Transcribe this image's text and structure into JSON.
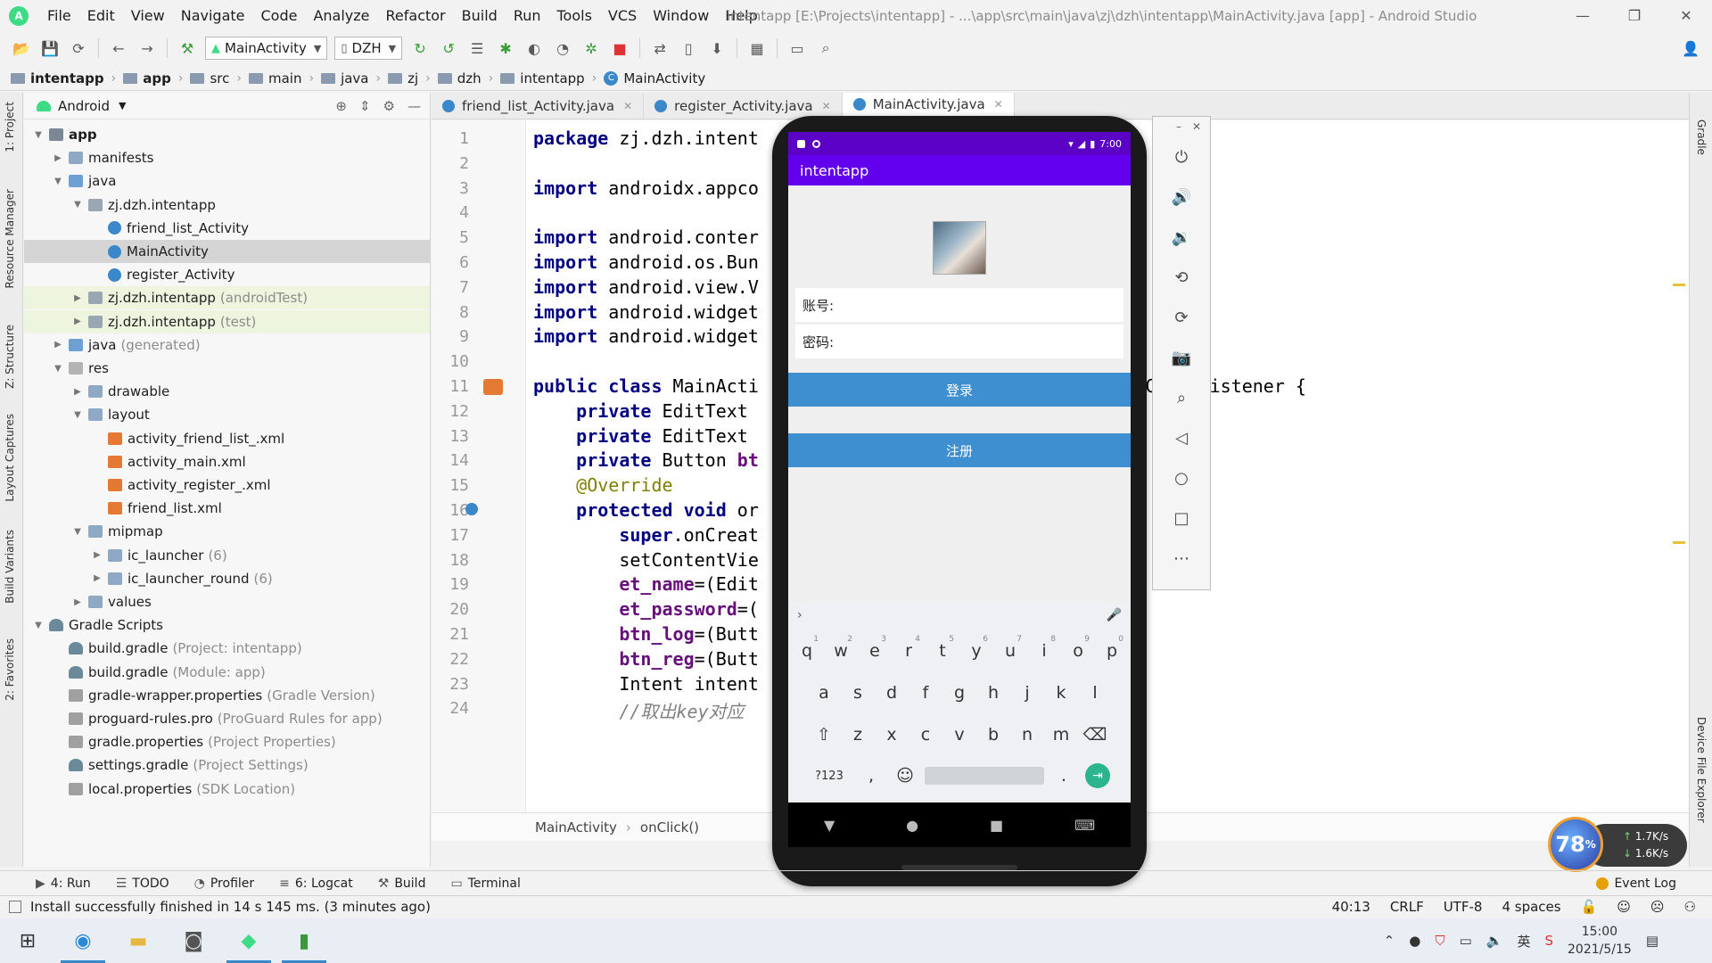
{
  "window": {
    "title": "intentapp [E:\\Projects\\intentapp] - ...\\app\\src\\main\\java\\zj\\dzh\\intentapp\\MainActivity.java [app] - Android Studio",
    "minimize": "—",
    "restore": "❐",
    "close": "✕"
  },
  "menu": [
    "File",
    "Edit",
    "View",
    "Navigate",
    "Code",
    "Analyze",
    "Refactor",
    "Build",
    "Run",
    "Tools",
    "VCS",
    "Window",
    "Help"
  ],
  "toolbar": {
    "run_config": "MainActivity",
    "device": "DZH"
  },
  "breadcrumb": [
    "intentapp",
    "app",
    "src",
    "main",
    "java",
    "zj",
    "dzh",
    "intentapp",
    "MainActivity"
  ],
  "left_strip": [
    "1: Project",
    "Resource Manager",
    "Z: Structure",
    "Layout Captures",
    "Build Variants",
    "2: Favorites"
  ],
  "right_strip": [
    "Gradle",
    "Device File Explorer"
  ],
  "project_panel": {
    "view_mode": "Android",
    "tree": [
      {
        "label": "app",
        "hint": "",
        "icon": "app",
        "depth": 0,
        "twisty": "▼",
        "bold": true
      },
      {
        "label": "manifests",
        "hint": "",
        "icon": "folder",
        "depth": 1,
        "twisty": "▶"
      },
      {
        "label": "java",
        "hint": "",
        "icon": "java",
        "depth": 1,
        "twisty": "▼"
      },
      {
        "label": "zj.dzh.intentapp",
        "hint": "",
        "icon": "pkg",
        "depth": 2,
        "twisty": "▼"
      },
      {
        "label": "friend_list_Activity",
        "hint": "",
        "icon": "cls",
        "depth": 3,
        "twisty": ""
      },
      {
        "label": "MainActivity",
        "hint": "",
        "icon": "cls",
        "depth": 3,
        "twisty": "",
        "selected": true
      },
      {
        "label": "register_Activity",
        "hint": "",
        "icon": "cls",
        "depth": 3,
        "twisty": ""
      },
      {
        "label": "zj.dzh.intentapp",
        "hint": "(androidTest)",
        "icon": "pkg",
        "depth": 2,
        "twisty": "▶",
        "test": true
      },
      {
        "label": "zj.dzh.intentapp",
        "hint": "(test)",
        "icon": "pkg",
        "depth": 2,
        "twisty": "▶",
        "test": true
      },
      {
        "label": "java",
        "hint": "(generated)",
        "icon": "java",
        "depth": 1,
        "twisty": "▶"
      },
      {
        "label": "res",
        "hint": "",
        "icon": "res",
        "depth": 1,
        "twisty": "▼"
      },
      {
        "label": "drawable",
        "hint": "",
        "icon": "folder",
        "depth": 2,
        "twisty": "▶"
      },
      {
        "label": "layout",
        "hint": "",
        "icon": "folder",
        "depth": 2,
        "twisty": "▼"
      },
      {
        "label": "activity_friend_list_.xml",
        "hint": "",
        "icon": "xml",
        "depth": 3,
        "twisty": ""
      },
      {
        "label": "activity_main.xml",
        "hint": "",
        "icon": "xml",
        "depth": 3,
        "twisty": ""
      },
      {
        "label": "activity_register_.xml",
        "hint": "",
        "icon": "xml",
        "depth": 3,
        "twisty": ""
      },
      {
        "label": "friend_list.xml",
        "hint": "",
        "icon": "xml",
        "depth": 3,
        "twisty": ""
      },
      {
        "label": "mipmap",
        "hint": "",
        "icon": "folder",
        "depth": 2,
        "twisty": "▼"
      },
      {
        "label": "ic_launcher",
        "hint": "(6)",
        "icon": "folder",
        "depth": 3,
        "twisty": "▶"
      },
      {
        "label": "ic_launcher_round",
        "hint": "(6)",
        "icon": "folder",
        "depth": 3,
        "twisty": "▶"
      },
      {
        "label": "values",
        "hint": "",
        "icon": "folder",
        "depth": 2,
        "twisty": "▶"
      },
      {
        "label": "Gradle Scripts",
        "hint": "",
        "icon": "grd",
        "depth": 0,
        "twisty": "▼"
      },
      {
        "label": "build.gradle",
        "hint": "(Project: intentapp)",
        "icon": "grd",
        "depth": 1,
        "twisty": ""
      },
      {
        "label": "build.gradle",
        "hint": "(Module: app)",
        "icon": "grd",
        "depth": 1,
        "twisty": ""
      },
      {
        "label": "gradle-wrapper.properties",
        "hint": "(Gradle Version)",
        "icon": "prop",
        "depth": 1,
        "twisty": ""
      },
      {
        "label": "proguard-rules.pro",
        "hint": "(ProGuard Rules for app)",
        "icon": "prop",
        "depth": 1,
        "twisty": ""
      },
      {
        "label": "gradle.properties",
        "hint": "(Project Properties)",
        "icon": "prop",
        "depth": 1,
        "twisty": ""
      },
      {
        "label": "settings.gradle",
        "hint": "(Project Settings)",
        "icon": "grd",
        "depth": 1,
        "twisty": ""
      },
      {
        "label": "local.properties",
        "hint": "(SDK Location)",
        "icon": "prop",
        "depth": 1,
        "twisty": ""
      }
    ]
  },
  "editor_tabs": [
    {
      "label": "friend_list_Activity.java",
      "active": false
    },
    {
      "label": "register_Activity.java",
      "active": false
    },
    {
      "label": "MainActivity.java",
      "active": true
    }
  ],
  "code_lines": [
    {
      "n": "1",
      "html": "<span class=\"kw\">package</span> zj.dzh.intent"
    },
    {
      "n": "2",
      "html": ""
    },
    {
      "n": "3",
      "html": "<span class=\"kw\">import</span> androidx.appco"
    },
    {
      "n": "4",
      "html": ""
    },
    {
      "n": "5",
      "html": "<span class=\"kw\">import</span> android.conter"
    },
    {
      "n": "6",
      "html": "<span class=\"kw\">import</span> android.os.Bun"
    },
    {
      "n": "7",
      "html": "<span class=\"kw\">import</span> android.view.V"
    },
    {
      "n": "8",
      "html": "<span class=\"kw\">import</span> android.widget"
    },
    {
      "n": "9",
      "html": "<span class=\"kw\">import</span> android.widget"
    },
    {
      "n": "10",
      "html": ""
    },
    {
      "n": "11",
      "html": "<span class=\"kw\">public class</span> MainActi                        <span class=\"kw\">ents</span> View.OnClickListener {"
    },
    {
      "n": "12",
      "html": "    <span class=\"kw\">private</span> EditText"
    },
    {
      "n": "13",
      "html": "    <span class=\"kw\">private</span> EditText"
    },
    {
      "n": "14",
      "html": "    <span class=\"kw\">private</span> Button <span class=\"fld\">bt</span>"
    },
    {
      "n": "15",
      "html": "    <span class=\"ann\">@Override</span>"
    },
    {
      "n": "16",
      "html": "    <span class=\"kw\">protected void</span> or                        ) {"
    },
    {
      "n": "17",
      "html": "        <span class=\"kw\">super</span>.onCreat"
    },
    {
      "n": "18",
      "html": "        setContentVie"
    },
    {
      "n": "19",
      "html": "        <span class=\"fld\">et_name</span>=(Edit                        );"
    },
    {
      "n": "20",
      "html": "        <span class=\"fld\">et_password</span>=(                        <span class=\"fld\">ssword</span>);"
    },
    {
      "n": "21",
      "html": "        <span class=\"fld\">btn_log</span>=(Butt"
    },
    {
      "n": "22",
      "html": "        <span class=\"fld\">btn_reg</span>=(Butt                        <span class=\"fld\">r</span>);"
    },
    {
      "n": "23",
      "html": "        Intent intent"
    },
    {
      "n": "24",
      "html": "        <span class=\"cmt\">//取出key对应</span>"
    }
  ],
  "editor_crumbs": [
    "MainActivity",
    "onClick()"
  ],
  "emulator": {
    "time": "7:00",
    "app_title": "intentapp",
    "account_label": "账号:",
    "password_label": "密码:",
    "login_button": "登录",
    "register_button": "注册",
    "keyboard": {
      "row1": [
        [
          "q",
          "1"
        ],
        [
          "w",
          "2"
        ],
        [
          "e",
          "3"
        ],
        [
          "r",
          "4"
        ],
        [
          "t",
          "5"
        ],
        [
          "y",
          "6"
        ],
        [
          "u",
          "7"
        ],
        [
          "i",
          "8"
        ],
        [
          "o",
          "9"
        ],
        [
          "p",
          "0"
        ]
      ],
      "row2": [
        "a",
        "s",
        "d",
        "f",
        "g",
        "h",
        "j",
        "k",
        "l"
      ],
      "row3": [
        "z",
        "x",
        "c",
        "v",
        "b",
        "n",
        "m"
      ],
      "symbols": "?123",
      "comma": ",",
      "period": "."
    }
  },
  "bottom_tools": [
    {
      "icon": "▶",
      "label": "4: Run"
    },
    {
      "icon": "☰",
      "label": "TODO"
    },
    {
      "icon": "◔",
      "label": "Profiler"
    },
    {
      "icon": "≡",
      "label": "6: Logcat"
    },
    {
      "icon": "⚒",
      "label": "Build"
    },
    {
      "icon": "▭",
      "label": "Terminal"
    }
  ],
  "event_log": "Event Log",
  "status": {
    "message": "Install successfully finished in 14 s 145 ms. (3 minutes ago)",
    "position": "40:13",
    "line_sep": "CRLF",
    "encoding": "UTF-8",
    "indent": "4 spaces"
  },
  "netspeed": {
    "percent": "78",
    "percent_unit": "%",
    "up": "1.7",
    "down": "1.6",
    "unit": "K/s"
  },
  "taskbar": {
    "time": "15:00",
    "date": "2021/5/15"
  }
}
